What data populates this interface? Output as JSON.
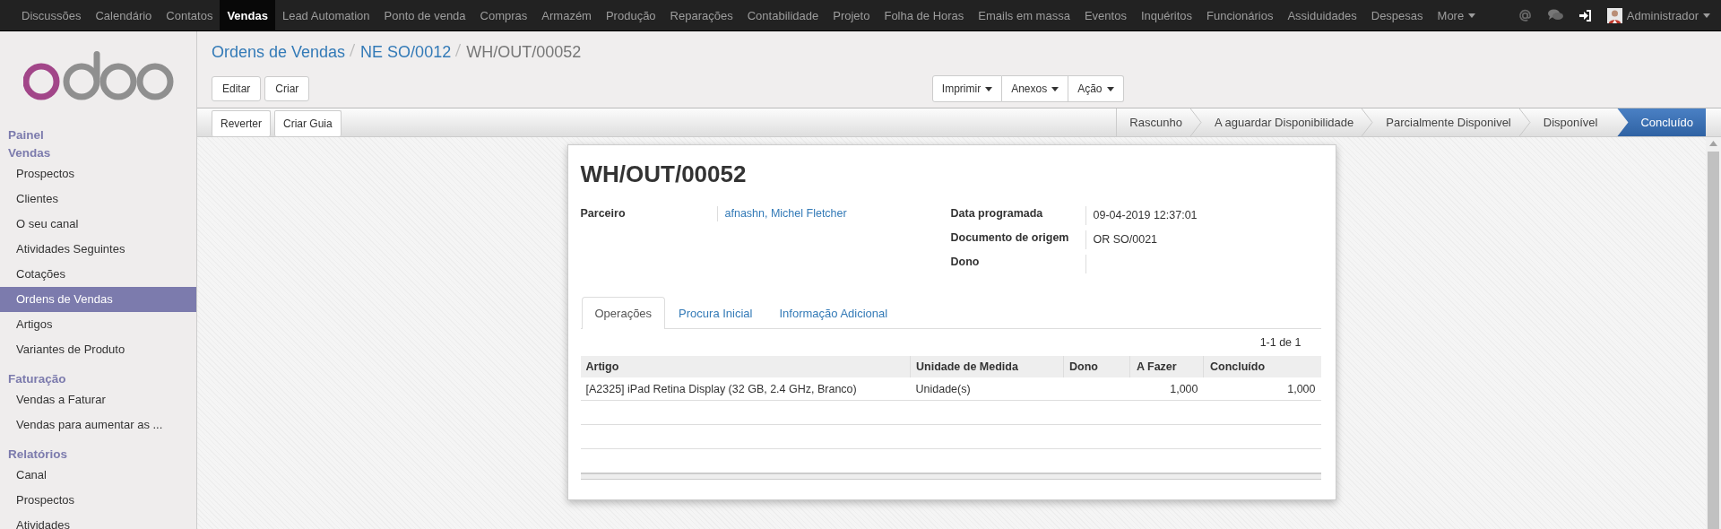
{
  "top_menu": {
    "items": [
      {
        "label": "Discussões",
        "selected": false
      },
      {
        "label": "Calendário",
        "selected": false
      },
      {
        "label": "Contatos",
        "selected": false
      },
      {
        "label": "Vendas",
        "selected": true
      },
      {
        "label": "Lead Automation",
        "selected": false
      },
      {
        "label": "Ponto de venda",
        "selected": false
      },
      {
        "label": "Compras",
        "selected": false
      },
      {
        "label": "Armazém",
        "selected": false
      },
      {
        "label": "Produção",
        "selected": false
      },
      {
        "label": "Reparações",
        "selected": false
      },
      {
        "label": "Contabilidade",
        "selected": false
      },
      {
        "label": "Projeto",
        "selected": false
      },
      {
        "label": "Folha de Horas",
        "selected": false
      },
      {
        "label": "Emails em massa",
        "selected": false
      },
      {
        "label": "Eventos",
        "selected": false
      },
      {
        "label": "Inquéritos",
        "selected": false
      },
      {
        "label": "Funcionários",
        "selected": false
      },
      {
        "label": "Assiduidades",
        "selected": false
      },
      {
        "label": "Despesas",
        "selected": false
      }
    ],
    "more": "More",
    "user": "Administrador"
  },
  "sidebar": {
    "sections": [
      {
        "title": "Painel"
      },
      {
        "title": "Vendas",
        "items": [
          {
            "label": "Prospectos",
            "selected": false
          },
          {
            "label": "Clientes",
            "selected": false
          },
          {
            "label": "O seu canal",
            "selected": false
          },
          {
            "label": "Atividades Seguintes",
            "selected": false
          },
          {
            "label": "Cotações",
            "selected": false
          },
          {
            "label": "Ordens de Vendas",
            "selected": true
          },
          {
            "label": "Artigos",
            "selected": false
          },
          {
            "label": "Variantes de Produto",
            "selected": false
          }
        ]
      },
      {
        "title": "Faturação",
        "items": [
          {
            "label": "Vendas a Faturar",
            "selected": false
          },
          {
            "label": "Vendas para aumentar as ...",
            "selected": false
          }
        ]
      },
      {
        "title": "Relatórios",
        "items": [
          {
            "label": "Canal",
            "selected": false
          },
          {
            "label": "Prospectos",
            "selected": false
          },
          {
            "label": "Atividades",
            "selected": false
          }
        ]
      }
    ]
  },
  "breadcrumb": [
    "Ordens de Vendas",
    "NE SO/0012",
    "WH/OUT/00052"
  ],
  "buttons": [
    "Editar",
    "Criar"
  ],
  "dropdowns": [
    "Imprimir",
    "Anexos",
    "Ação"
  ],
  "action_buttons": [
    "Reverter",
    "Criar Guia"
  ],
  "stages": [
    {
      "label": "Rascunho",
      "selected": false
    },
    {
      "label": "A aguardar Disponibilidade",
      "selected": false
    },
    {
      "label": "Parcialmente Disponivel",
      "selected": false
    },
    {
      "label": "Disponível",
      "selected": false
    },
    {
      "label": "Concluído",
      "selected": true
    }
  ],
  "record": {
    "title": "WH/OUT/00052",
    "left_fields": [
      {
        "label": "Parceiro",
        "value": "afnashn, Michel Fletcher",
        "kind": "link"
      }
    ],
    "right_fields": [
      {
        "label": "Data programada",
        "value": "09-04-2019 12:37:01",
        "kind": "text"
      },
      {
        "label": "Documento de origem",
        "value": "OR SO/0021",
        "kind": "text"
      },
      {
        "label": "Dono",
        "kind": "text"
      }
    ],
    "tabs": [
      {
        "label": "Operações",
        "selected": true
      },
      {
        "label": "Procura Inicial",
        "selected": false
      },
      {
        "label": "Informação Adicional",
        "selected": false
      }
    ],
    "pager": "1-1 de 1",
    "table": {
      "columns": [
        {
          "label": "Artigo",
          "numeric": false
        },
        {
          "label": "Unidade de Medida",
          "numeric": false
        },
        {
          "label": "Dono",
          "numeric": false
        },
        {
          "label": "A Fazer",
          "numeric": true
        },
        {
          "label": "Concluído",
          "numeric": true
        }
      ],
      "rows": [
        [
          "[A2325] iPad Retina Display (32 GB, 2.4 GHz, Branco)",
          "Unidade(s)",
          "",
          "1,000",
          "1,000"
        ]
      ]
    }
  }
}
